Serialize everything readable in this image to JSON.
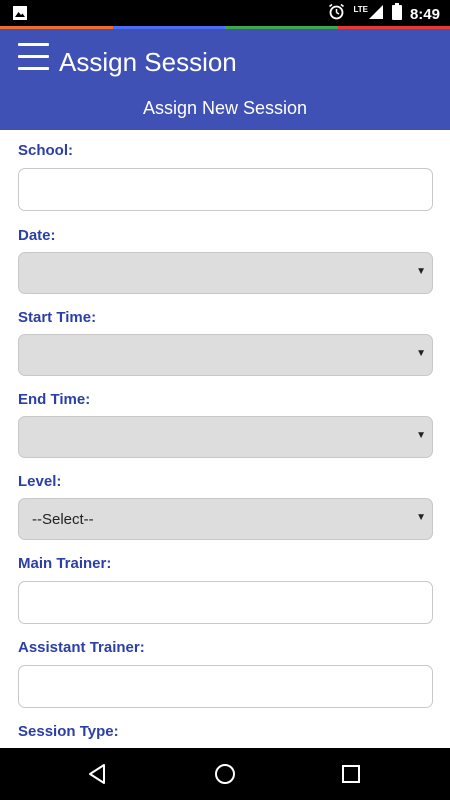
{
  "status_bar": {
    "time": "8:49",
    "network": "LTE",
    "icons": [
      "image-icon",
      "alarm-icon",
      "signal-icon",
      "battery-icon"
    ]
  },
  "accent_colors": [
    "#ef6c2e",
    "#4c6ef5",
    "#3fa64c",
    "#e53935"
  ],
  "app_bar": {
    "title": "Assign Session",
    "subtitle": "Assign New Session",
    "menu_icon": "hamburger-menu-icon",
    "color": "#3f51b5"
  },
  "form": {
    "school": {
      "label": "School:",
      "value": ""
    },
    "date": {
      "label": "Date:",
      "value": ""
    },
    "start_time": {
      "label": "Start Time:",
      "value": ""
    },
    "end_time": {
      "label": "End Time:",
      "value": ""
    },
    "level": {
      "label": "Level:",
      "value": "--Select--"
    },
    "main_trainer": {
      "label": "Main Trainer:",
      "value": ""
    },
    "assistant_trainer": {
      "label": "Assistant Trainer:",
      "value": ""
    },
    "session_type": {
      "label": "Session Type:"
    }
  },
  "nav_bar": {
    "icons": [
      "back-icon",
      "home-icon",
      "recents-icon"
    ]
  }
}
